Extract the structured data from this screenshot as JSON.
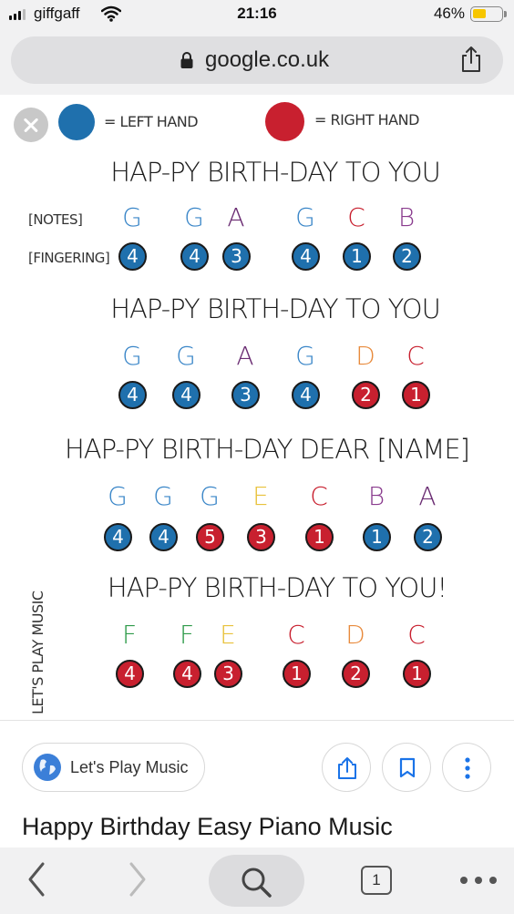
{
  "status": {
    "carrier": "giffgaff",
    "time": "21:16",
    "battery_percent": "46%",
    "battery_level": 0.46,
    "battery_color": "#f7c600"
  },
  "browser": {
    "url": "google.co.uk",
    "lock_icon": "lock-icon",
    "share_icon": "share-icon"
  },
  "sheet": {
    "legend": {
      "left_label": "= LEFT HAND",
      "right_label": "= RIGHT HAND",
      "left_color": "#1f70ad",
      "right_color": "#c8202f"
    },
    "row_labels": {
      "notes": "[NOTES]",
      "fingering": "[FINGERING]"
    },
    "watermark": "LET'S PLAY MUSIC",
    "lines": [
      {
        "lyric": "HAP-PY BIRTH-DAY TO YOU",
        "notes": [
          {
            "note": "G",
            "color": "#3a86c8",
            "finger": "4",
            "hand": "left"
          },
          {
            "note": "G",
            "color": "#3a86c8",
            "finger": "4",
            "hand": "left"
          },
          {
            "note": "A",
            "color": "#6b2d73",
            "finger": "3",
            "hand": "left"
          },
          {
            "note": "G",
            "color": "#3a86c8",
            "finger": "4",
            "hand": "left"
          },
          {
            "note": "C",
            "color": "#c8202f",
            "finger": "1",
            "hand": "left"
          },
          {
            "note": "B",
            "color": "#8a3c8e",
            "finger": "2",
            "hand": "left"
          }
        ]
      },
      {
        "lyric": "HAP-PY BIRTH-DAY TO YOU",
        "notes": [
          {
            "note": "G",
            "color": "#3a86c8",
            "finger": "4",
            "hand": "left"
          },
          {
            "note": "G",
            "color": "#3a86c8",
            "finger": "4",
            "hand": "left"
          },
          {
            "note": "A",
            "color": "#6b2d73",
            "finger": "3",
            "hand": "left"
          },
          {
            "note": "G",
            "color": "#3a86c8",
            "finger": "4",
            "hand": "left"
          },
          {
            "note": "D",
            "color": "#e88a3c",
            "finger": "2",
            "hand": "right"
          },
          {
            "note": "C",
            "color": "#c8202f",
            "finger": "1",
            "hand": "right"
          }
        ]
      },
      {
        "lyric": "HAP-PY BIRTH-DAY DEAR [NAME]",
        "notes": [
          {
            "note": "G",
            "color": "#3a86c8",
            "finger": "4",
            "hand": "left"
          },
          {
            "note": "G",
            "color": "#3a86c8",
            "finger": "4",
            "hand": "left"
          },
          {
            "note": "G",
            "color": "#3a86c8",
            "finger": "5",
            "hand": "right"
          },
          {
            "note": "E",
            "color": "#e8c23c",
            "finger": "3",
            "hand": "right"
          },
          {
            "note": "C",
            "color": "#c8202f",
            "finger": "1",
            "hand": "right"
          },
          {
            "note": "B",
            "color": "#8a3c8e",
            "finger": "1",
            "hand": "left"
          },
          {
            "note": "A",
            "color": "#6b2d73",
            "finger": "2",
            "hand": "left"
          }
        ]
      },
      {
        "lyric": "HAP-PY BIRTH-DAY TO YOU!",
        "notes": [
          {
            "note": "F",
            "color": "#2e9a4a",
            "finger": "4",
            "hand": "right"
          },
          {
            "note": "F",
            "color": "#2e9a4a",
            "finger": "4",
            "hand": "right"
          },
          {
            "note": "E",
            "color": "#e8c23c",
            "finger": "3",
            "hand": "right"
          },
          {
            "note": "C",
            "color": "#c8202f",
            "finger": "1",
            "hand": "right"
          },
          {
            "note": "D",
            "color": "#e88a3c",
            "finger": "2",
            "hand": "right"
          },
          {
            "note": "C",
            "color": "#c8202f",
            "finger": "1",
            "hand": "right"
          }
        ]
      }
    ]
  },
  "result": {
    "site_name": "Let's Play Music",
    "title": "Happy Birthday Easy Piano Music",
    "actions": [
      "share-icon",
      "bookmark-icon",
      "more-vertical-icon"
    ]
  },
  "toolbar": {
    "back_icon": "back-chevron-icon",
    "forward_icon": "forward-chevron-icon",
    "search_icon": "search-icon",
    "tab_count": "1",
    "more_icon": "more-horizontal-icon"
  }
}
